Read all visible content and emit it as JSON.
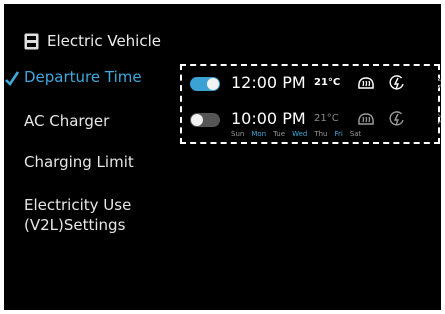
{
  "header": {
    "title": "Electric Vehicle"
  },
  "menu": [
    {
      "label": "Departure Time",
      "active": true
    },
    {
      "label": "AC Charger",
      "active": false
    },
    {
      "label": "Charging Limit",
      "active": false
    },
    {
      "label": "Electricity Use",
      "active": false
    },
    {
      "label": "(V2L)Settings",
      "active": false
    }
  ],
  "schedules": [
    {
      "enabled": true,
      "time": "12:00 PM",
      "temperature": "21°C",
      "days": []
    },
    {
      "enabled": false,
      "time": "10:00 PM",
      "temperature": "21°C",
      "days": [
        {
          "label": "Sun",
          "selected": false
        },
        {
          "label": "Mon",
          "selected": true
        },
        {
          "label": "Tue",
          "selected": false
        },
        {
          "label": "Wed",
          "selected": true
        },
        {
          "label": "Thu",
          "selected": false
        },
        {
          "label": "Fri",
          "selected": true
        },
        {
          "label": "Sat",
          "selected": false
        }
      ]
    }
  ],
  "icons": {
    "header": "ev-icon",
    "checkmark": "check-icon",
    "defrost": "defrost-icon",
    "charge": "charging-icon",
    "chevron": "chevron-right-icon"
  },
  "colors": {
    "accent": "#3fa9dc",
    "toggle_on": "#3aa3d4",
    "toggle_off": "#555555",
    "background": "#000000"
  }
}
